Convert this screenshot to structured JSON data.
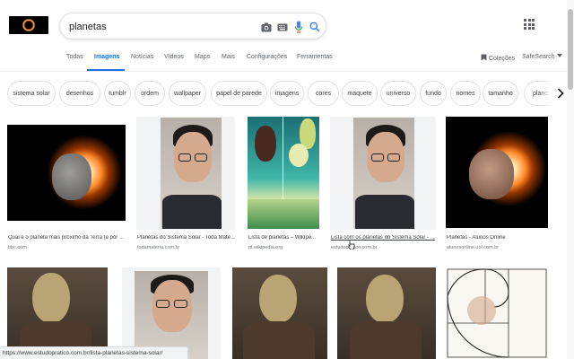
{
  "search": {
    "query": "planetas"
  },
  "tabs": [
    "Todas",
    "Imagens",
    "Notícias",
    "Vídeos",
    "Maps",
    "Mais",
    "Configurações",
    "Ferramentas"
  ],
  "right_links": {
    "collections": "Coleções",
    "safesearch": "SafeSearch"
  },
  "chips": [
    "sistema solar",
    "desenhos",
    "tumblr",
    "ordem",
    "wallpaper",
    "papel de parede",
    "imagens",
    "cores",
    "maquete",
    "universo",
    "fundo",
    "nomes",
    "tamanho",
    "plano de"
  ],
  "results": [
    {
      "caption": "Qual é o planeta mais próximo da Terra (e por ...",
      "domain": "bbc.com"
    },
    {
      "caption": "Planetas do Sistema Solar - Toda Matéria",
      "domain": "todamateria.com.br"
    },
    {
      "caption": "Lista de planetas – Wikipe...",
      "domain": "pt.wikipedia.org"
    },
    {
      "caption": "Lista com os planetas do Sistema Solar - ...",
      "domain": "estudopratico.com.br"
    },
    {
      "caption": "Planetas - Alunos Online",
      "domain": "alunosonline.uol.com.br"
    }
  ],
  "status_bar": {
    "url": "https://www.estudopratico.com.br/lista-planetas-sistema-solar/"
  },
  "colors": {
    "accent": "#1a73e8",
    "chip_border": "#dfe1e5"
  }
}
